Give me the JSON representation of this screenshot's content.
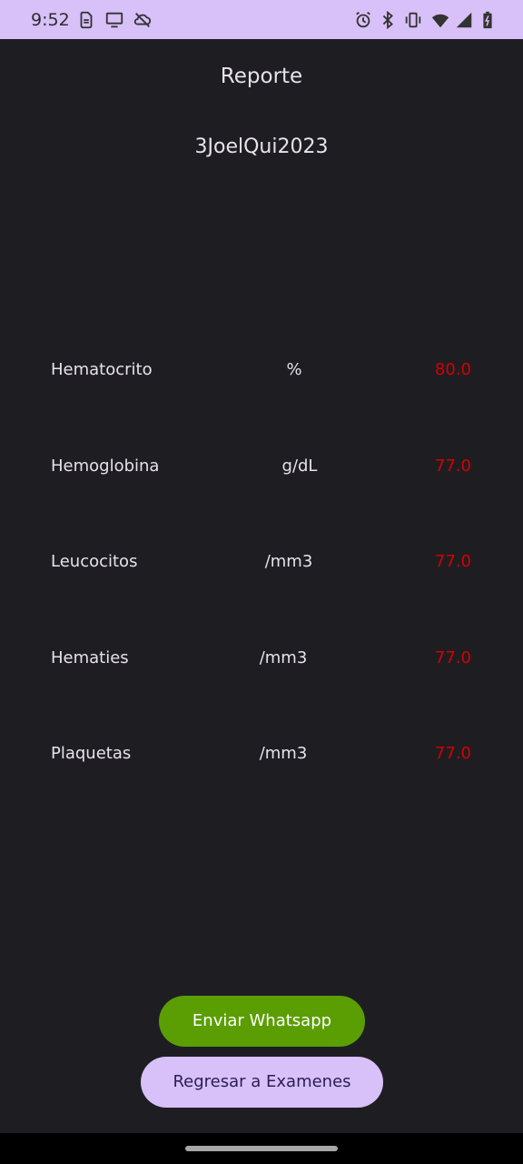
{
  "status_bar": {
    "time": "9:52",
    "left_icons": [
      "sim-icon",
      "cast-icon",
      "cloud-off-icon"
    ],
    "right_icons": [
      "alarm-icon",
      "bluetooth-icon",
      "vibrate-icon",
      "wifi-icon",
      "signal-icon",
      "battery-icon"
    ]
  },
  "header": {
    "title": "Reporte",
    "report_code": "3JoelQui2023"
  },
  "results": [
    {
      "name": "Hematocrito",
      "unit": "%",
      "value": "80.0"
    },
    {
      "name": "Hemoglobina",
      "unit": "g/dL",
      "value": "77.0"
    },
    {
      "name": "Leucocitos",
      "unit": "/mm3",
      "value": "77.0"
    },
    {
      "name": "Hematies",
      "unit": "/mm3",
      "value": "77.0"
    },
    {
      "name": "Plaquetas",
      "unit": "/mm3",
      "value": "77.0"
    }
  ],
  "buttons": {
    "send_whatsapp": "Enviar Whatsapp",
    "back_to_exams": "Regresar a Examenes"
  },
  "colors": {
    "background": "#1e1e22",
    "accent": "#d7c1f8",
    "value_red": "#d40000",
    "whatsapp_green": "#5b9e04"
  }
}
